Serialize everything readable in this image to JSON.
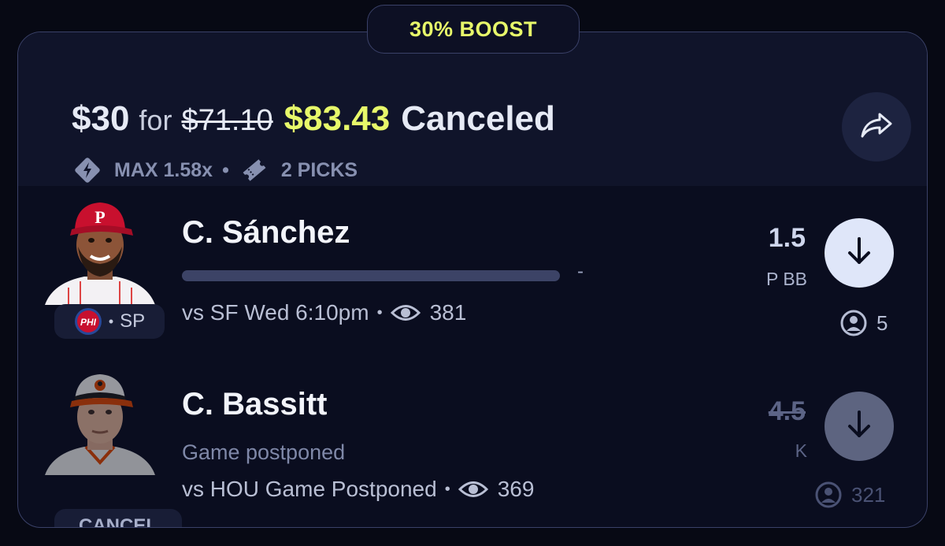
{
  "boost": {
    "label": "30% BOOST"
  },
  "entry": {
    "stake": "$30",
    "for_text": "for",
    "original_payout": "$71.10",
    "boosted_payout": "$83.43",
    "status": "Canceled",
    "max_multiplier": "MAX 1.58x",
    "separator": "•",
    "picks_count": "2 PICKS"
  },
  "picks": [
    {
      "player": "C. Sánchez",
      "team_abbr": "PHI",
      "badge_sep": "•",
      "position": "SP",
      "progress_value": "-",
      "progress_fraction": 0,
      "matchup": "vs SF Wed 6:10pm",
      "sep": "•",
      "views": "381",
      "line": "1.5",
      "stat": "P BB",
      "direction": "lower",
      "entries": "5"
    },
    {
      "player": "C. Bassitt",
      "status_badge": "CANCEL",
      "note": "Game postponed",
      "matchup": "vs HOU Game Postponed",
      "sep": "•",
      "views": "369",
      "line": "4.5",
      "stat": "K",
      "direction": "lower",
      "entries": "321"
    }
  ],
  "colors": {
    "accent": "#e7f86a",
    "phi_red": "#c8102e",
    "phi_blue": "#284898",
    "orioles_orange": "#df4601"
  },
  "icons": {
    "share": "share-arrow-icon",
    "multiplier": "lightning-diamond-icon",
    "picks": "ticket-icon",
    "views": "eye-icon",
    "direction": "arrow-down-icon",
    "entries": "user-circle-icon"
  }
}
